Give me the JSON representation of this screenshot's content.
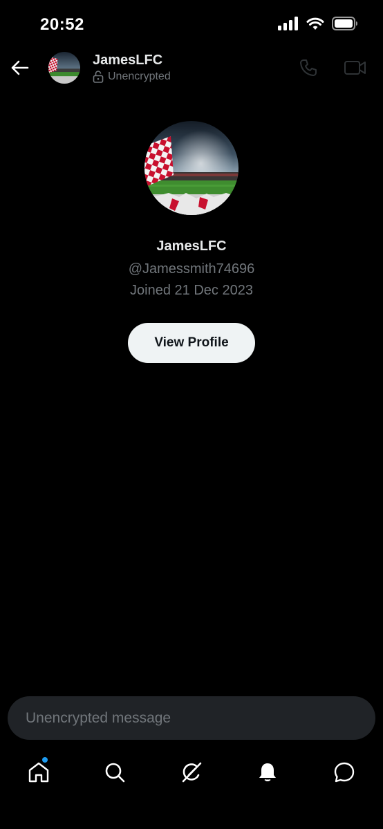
{
  "status_bar": {
    "time": "20:52"
  },
  "header": {
    "back_icon": "arrow-left-icon",
    "name": "JamesLFC",
    "subtitle": "Unencrypted",
    "lock_icon": "unlocked-padlock-icon",
    "call_icon": "phone-icon",
    "video_icon": "video-camera-icon"
  },
  "profile": {
    "name": "JamesLFC",
    "handle": "@Jamessmith74696",
    "joined": "Joined 21 Dec 2023",
    "view_profile_label": "View Profile"
  },
  "composer": {
    "placeholder": "Unencrypted message"
  },
  "bottom_nav": {
    "items": [
      "home-icon",
      "search-icon",
      "grok-icon",
      "bell-icon",
      "messages-icon"
    ],
    "home_has_notification": true
  },
  "colors": {
    "background": "#000000",
    "text_primary": "#e7e9ea",
    "text_secondary": "#71767b",
    "button_light": "#eff3f4",
    "composer_bg": "#202327",
    "accent": "#1d9bf0"
  }
}
